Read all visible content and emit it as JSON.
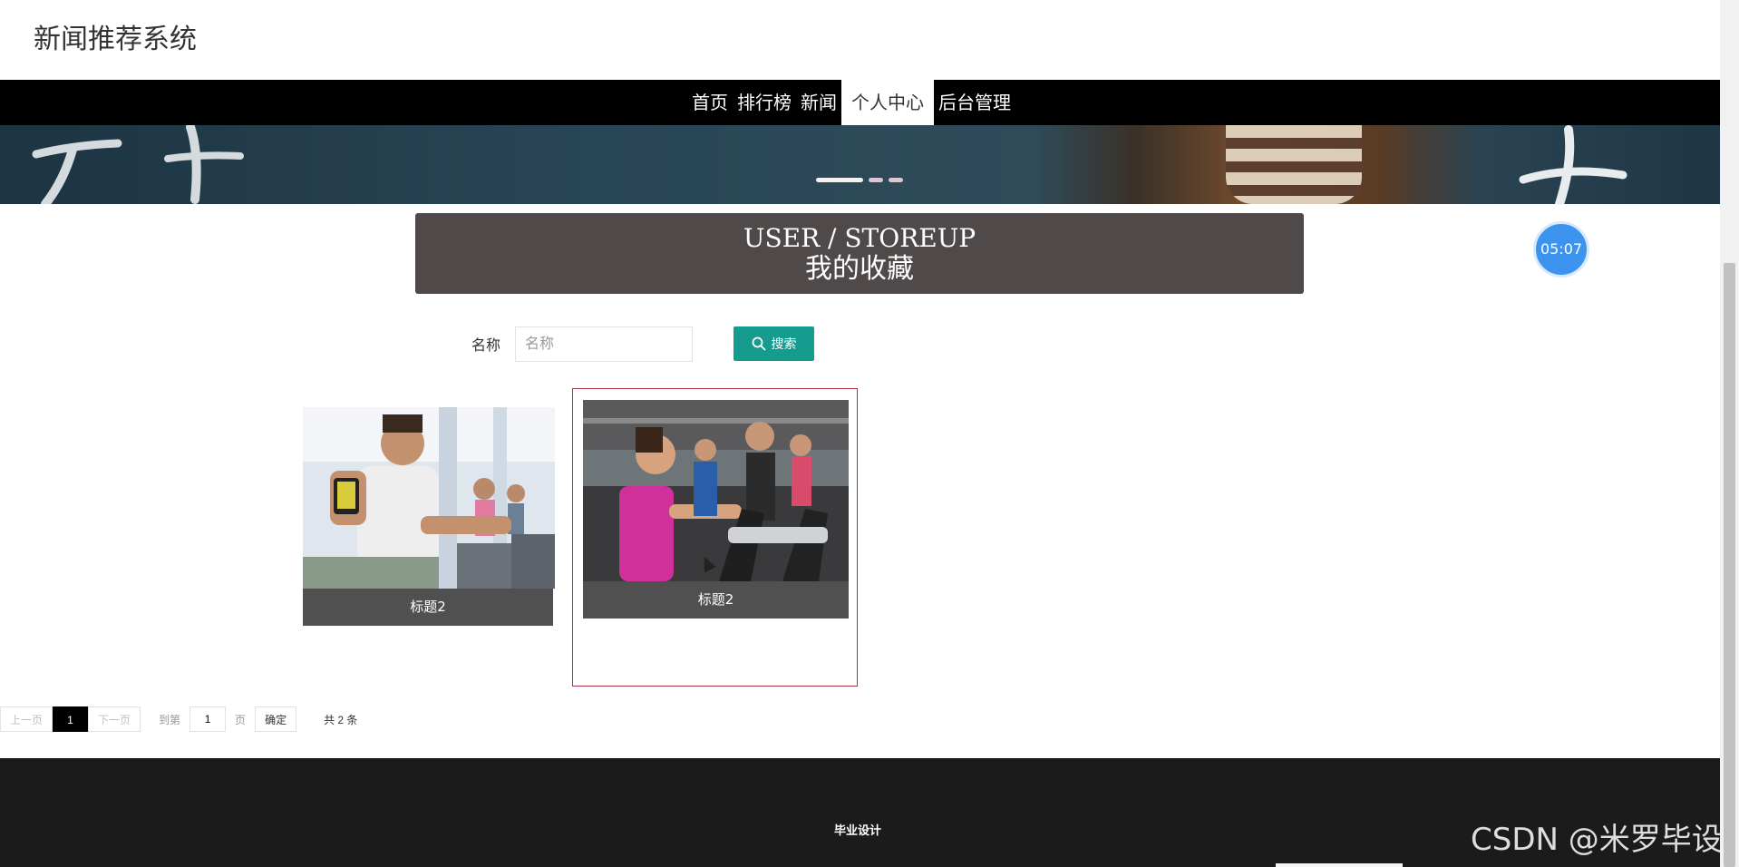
{
  "site": {
    "title": "新闻推荐系统"
  },
  "nav": {
    "items": [
      "首页",
      "排行榜",
      "新闻",
      "个人中心",
      "后台管理"
    ],
    "active": "个人中心"
  },
  "section": {
    "title_en": "USER / STOREUP",
    "title_cn": "我的收藏"
  },
  "clock": {
    "time": "05:07"
  },
  "search": {
    "label": "名称",
    "placeholder": "名称",
    "value": "",
    "button_label": "搜索",
    "button_color": "#159c8f"
  },
  "cards": [
    {
      "title": "标题2",
      "image": "man-on-exercise-bike-icon"
    },
    {
      "title": "标题2",
      "image": "woman-on-elliptical-icon"
    }
  ],
  "pager": {
    "prev": "上一页",
    "current": "1",
    "next": "下一页",
    "goto_prefix": "到第",
    "goto_value": "1",
    "goto_suffix": "页",
    "confirm": "确定",
    "total": "共 2 条"
  },
  "footer": {
    "text": "毕业设计"
  },
  "watermark": "CSDN @米罗毕设",
  "colors": {
    "nav_bg": "#000000",
    "section_bg": "#4f4949",
    "footer_bg": "#1b1b1b",
    "accent": "#159c8f",
    "card_border": "#a8323e"
  }
}
